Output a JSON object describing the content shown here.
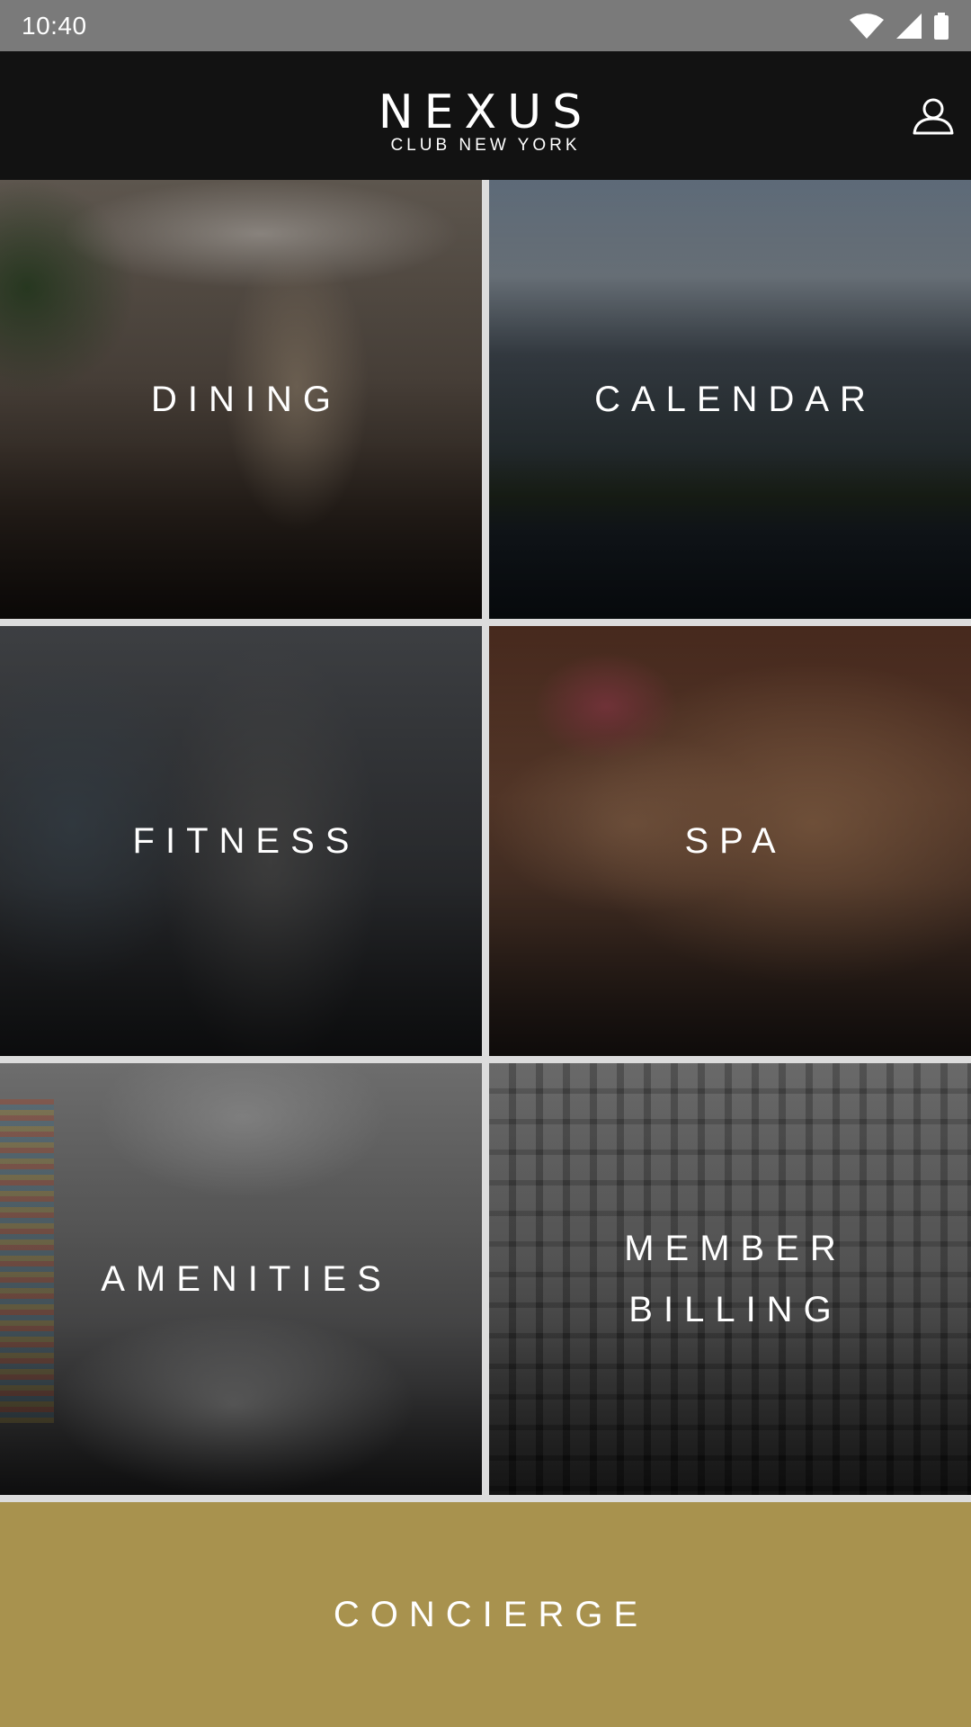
{
  "status_bar": {
    "time": "10:40",
    "icons": [
      "wifi-icon",
      "cell-signal-icon",
      "battery-icon"
    ]
  },
  "header": {
    "logo_mark": "NEXUS",
    "logo_sub": "CLUB NEW YORK",
    "profile_icon": "user-profile-icon"
  },
  "tiles": [
    {
      "label": "DINING"
    },
    {
      "label": "CALENDAR"
    },
    {
      "label": "FITNESS"
    },
    {
      "label": "SPA"
    },
    {
      "label": "AMENITIES"
    },
    {
      "label": "MEMBER\nBILLING"
    }
  ],
  "concierge": {
    "label": "CONCIERGE"
  },
  "colors": {
    "status_bar": "#7a7a7a",
    "header_bg": "#121212",
    "concierge_gold": "#a8924e",
    "grid_divider": "#dcdcdc"
  }
}
